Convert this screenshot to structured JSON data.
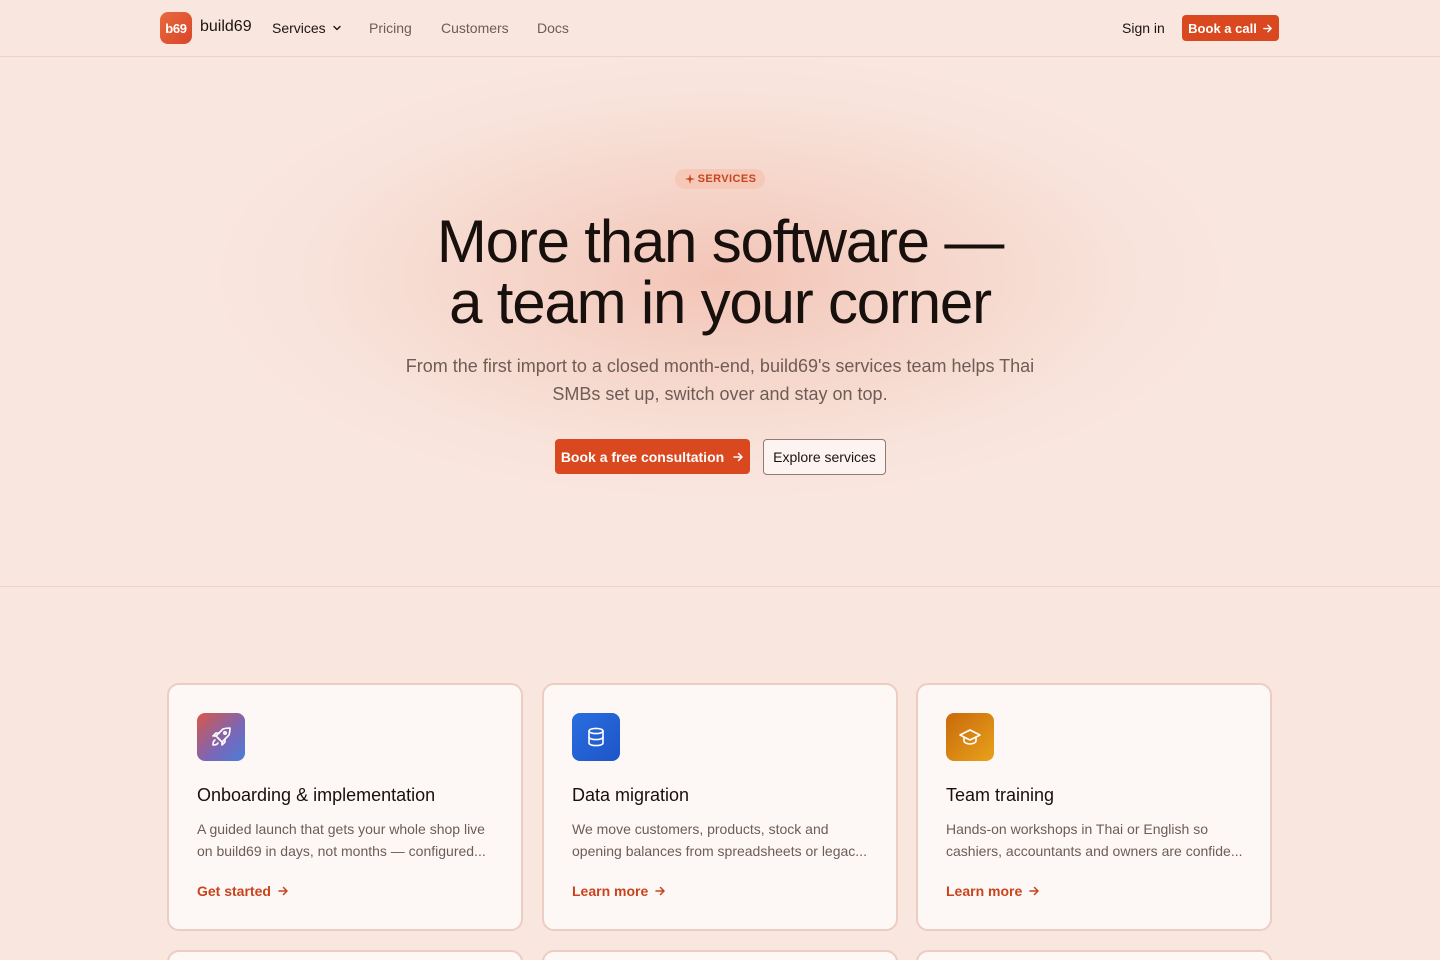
{
  "brand": {
    "logo_text": "b69",
    "name": "build69"
  },
  "nav": {
    "items": [
      {
        "label": "Services"
      },
      {
        "label": "Pricing"
      },
      {
        "label": "Customers"
      },
      {
        "label": "Docs"
      }
    ],
    "sign_in": "Sign in",
    "cta": "Book a call"
  },
  "hero": {
    "eyebrow": "SERVICES",
    "title_line1": "More than software —",
    "title_line2": "a team in your corner",
    "subtitle": "From the first import to a closed month-end, build69's services team helps Thai SMBs set up, switch over and stay on top.",
    "primary_cta": "Book a free consultation",
    "secondary_cta": "Explore services"
  },
  "services": [
    {
      "icon": "rocket-icon",
      "title": "Onboarding & implementation",
      "description": "A guided launch that gets your whole shop live on build69 in days, not months — configured...",
      "link": "Get started"
    },
    {
      "icon": "database-icon",
      "title": "Data migration",
      "description": "We move customers, products, stock and opening balances from spreadsheets or legac...",
      "link": "Learn more"
    },
    {
      "icon": "graduation-cap-icon",
      "title": "Team training",
      "description": "Hands-on workshops in Thai or English so cashiers, accountants and owners are confide...",
      "link": "Learn more"
    }
  ],
  "colors": {
    "accent": "#d9481e",
    "background": "#f9e6df",
    "card_border": "#eccdc2"
  }
}
